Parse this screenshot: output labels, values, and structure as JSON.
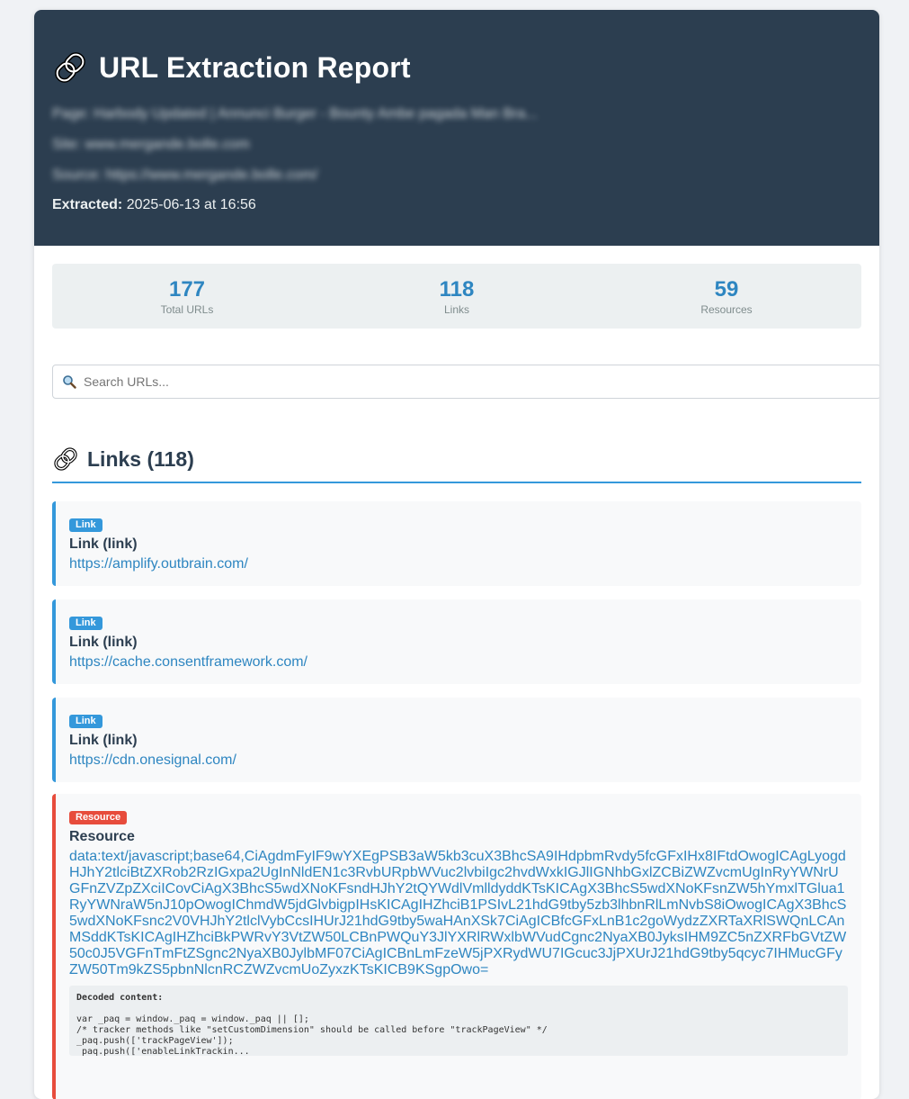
{
  "header": {
    "title": "URL Extraction Report",
    "page_line": "Page: Harbody Updated | Annunci Burger - Bounty Ambe pagada Man Bra...",
    "site_line": "Site: www.mergande.bolle.com",
    "source_line": "Source: https://www.mergande.bolle.com/",
    "extracted_label": "Extracted:",
    "extracted_value": "2025-06-13 at 16:56"
  },
  "stats": [
    {
      "value": "177",
      "label": "Total URLs"
    },
    {
      "value": "118",
      "label": "Links"
    },
    {
      "value": "59",
      "label": "Resources"
    }
  ],
  "search": {
    "placeholder": "Search URLs..."
  },
  "section": {
    "title": "Links (118)",
    "icon": "link-icon"
  },
  "items": [
    {
      "badge": "Link",
      "title": "Link (link)",
      "url": "https://amplify.outbrain.com/"
    },
    {
      "badge": "Link",
      "title": "Link (link)",
      "url": "https://cache.consentframework.com/"
    },
    {
      "badge": "Link",
      "title": "Link (link)",
      "url": "https://cdn.onesignal.com/"
    },
    {
      "badge": "Resource",
      "title": "Resource",
      "url": "data:text/javascript;base64,CiAgdmFyIF9wYXEgPSB3aW5kb3cuX3BhcSA9IHdpbmRvdy5fcGFxIHx8IFtdOwogICAgLyogdHJhY2tlciBtZXRob2RzIGxpa2UgInNldEN1c3RvbURpbWVuc2lvbiIgc2hvdWxkIGJlIGNhbGxlZCBiZWZvcmUgInRyYWNrUGFnZVZpZXciICovCiAgX3BhcS5wdXNoKFsndHJhY2tQYWdlVmlldyddKTsKICAgX3BhcS5wdXNoKFsnZW5hYmxlTGlua1RyYWNraW5nJ10pOwogIChmdW5jdGlvbigpIHsKICAgIHZhciB1PSIvL21hdG9tby5zb3lhbnRlLmNvbS8iOwogICAgX3BhcS5wdXNoKFsnc2V0VHJhY2tlclVybCcsIHUrJ21hdG9tby5waHAnXSk7CiAgICBfcGFxLnB1c2goWydzZXRTaXRlSWQnLCAnMSddKTsKICAgIHZhciBkPWRvY3VtZW50LCBnPWQuY3JlYXRlRWxlbWVudCgnc2NyaXB0JyksIHM9ZC5nZXRFbGVtZW50c0J5VGFnTmFtZSgnc2NyaXB0JylbMF07CiAgICBnLmFzeW5jPXRydWU7IGcuc3JjPXUrJ21hdG9tby5qcyc7IHMucGFyZW50Tm9kZS5pbnNlcnRCZWZvcmUoZyxzKTsKICB9KSgpOwo=",
      "decoded_label": "Decoded content:",
      "decoded_code": "var _paq = window._paq = window._paq || [];\n/* tracker methods like \"setCustomDimension\" should be called before \"trackPageView\" */\n_paq.push(['trackPageView']);\n_paq.push(['enableLinkTrackin..."
    }
  ]
}
